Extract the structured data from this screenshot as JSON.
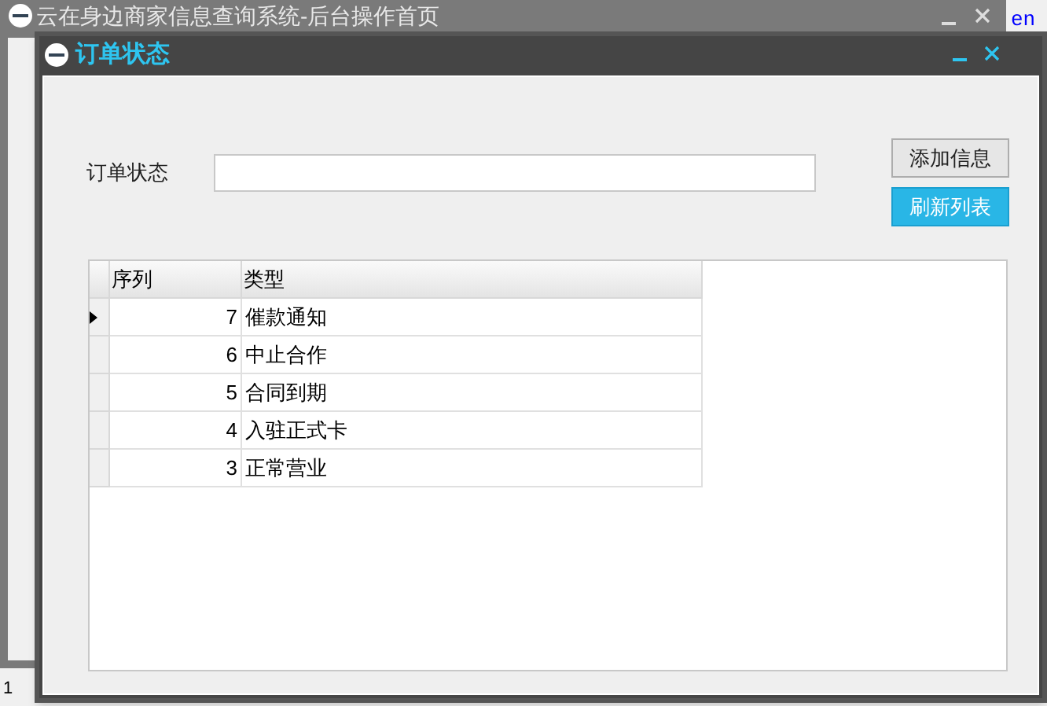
{
  "main_window": {
    "title": "云在身边商家信息查询系统-后台操作首页",
    "side_text": "en",
    "status_text": "1"
  },
  "dialog": {
    "title": "订单状态",
    "form": {
      "label": "订单状态"
    },
    "buttons": [
      {
        "label": "添加信息",
        "kind": "normal"
      },
      {
        "label": "刷新列表",
        "kind": "primary"
      }
    ],
    "table": {
      "columns": [
        "序列",
        "类型"
      ],
      "rows": [
        {
          "cells": [
            "7",
            "催款通知"
          ],
          "selected": true
        },
        {
          "cells": [
            "6",
            "中止合作"
          ],
          "selected": false
        },
        {
          "cells": [
            "5",
            "合同到期"
          ],
          "selected": false
        },
        {
          "cells": [
            "4",
            "入驻正式卡"
          ],
          "selected": false
        },
        {
          "cells": [
            "3",
            "正常营业"
          ],
          "selected": false
        }
      ]
    }
  }
}
